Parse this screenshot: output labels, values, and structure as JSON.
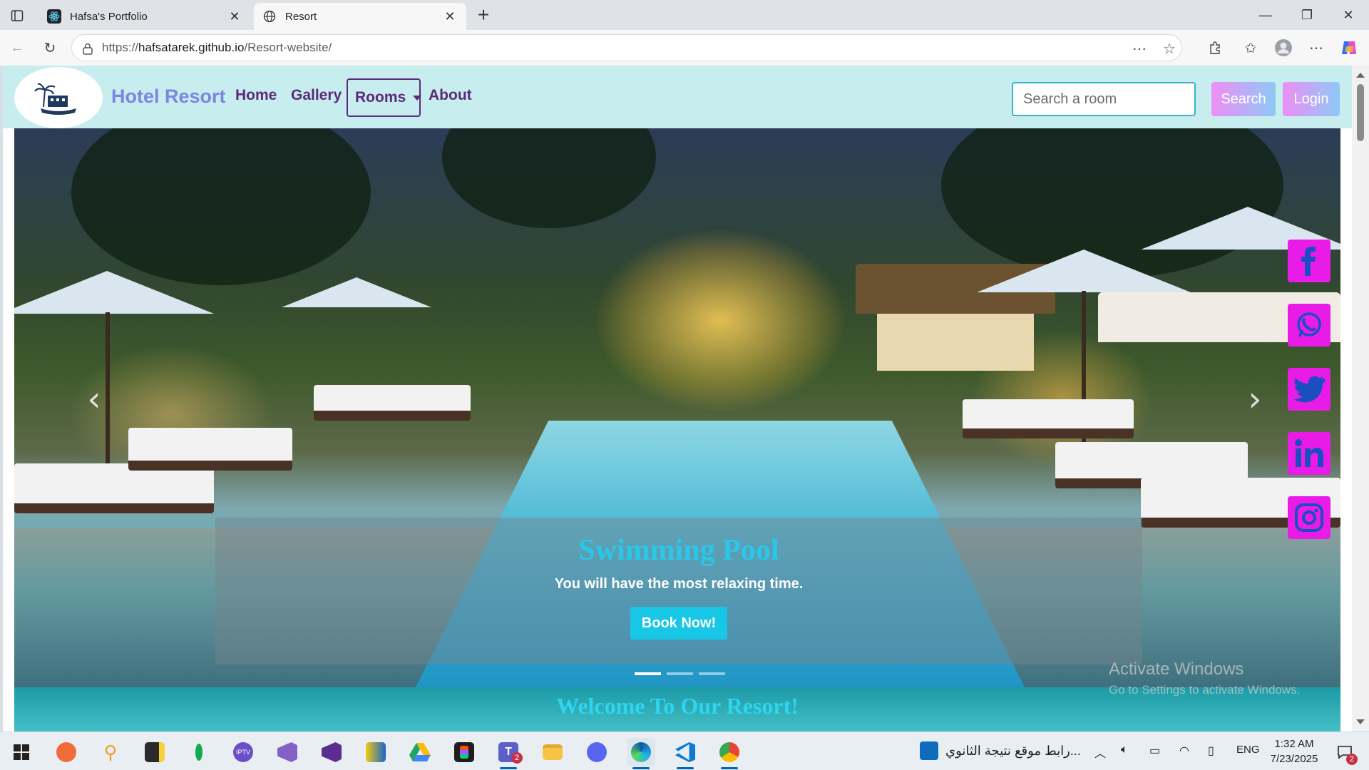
{
  "browser": {
    "tabs": [
      {
        "title": "Hafsa's Portfolio",
        "active": false
      },
      {
        "title": "Resort",
        "active": true
      }
    ],
    "address": {
      "prefix": "https://",
      "host": "hafsatarek.github.io",
      "path": "/Resort-website/"
    }
  },
  "page": {
    "nav": {
      "brand": "Hotel Resort",
      "links": [
        "Home",
        "Gallery",
        "Rooms",
        "About"
      ],
      "search_placeholder": "Search a room",
      "search_button": "Search",
      "login_button": "Login"
    },
    "carousel": {
      "title": "Swimming Pool",
      "text": "You will have the most relaxing time.",
      "button": "Book Now!",
      "slide_count": 3,
      "active_slide": 1
    },
    "social_icons": [
      "facebook-icon",
      "whatsapp-icon",
      "twitter-icon",
      "linkedin-icon",
      "instagram-icon"
    ],
    "welcome": "Welcome To Our Resort!",
    "colors": {
      "nav_bg": "#bdeaec",
      "nav_link": "#5c2a7a",
      "brand": "#7a86e0",
      "caption_title": "#29c8ea",
      "book_button": "#18c6e6",
      "social": "#e81ce6",
      "welcome_text": "#2fd4f0"
    }
  },
  "watermark": {
    "line1": "Activate Windows",
    "line2": "Go to Settings to activate Windows."
  },
  "taskbar": {
    "notification": "رابط موقع نتيجة الثانوي...",
    "language": "ENG",
    "time": "1:32 AM",
    "date": "7/23/2025",
    "teams_badge": "2",
    "notif_badge": "2"
  }
}
